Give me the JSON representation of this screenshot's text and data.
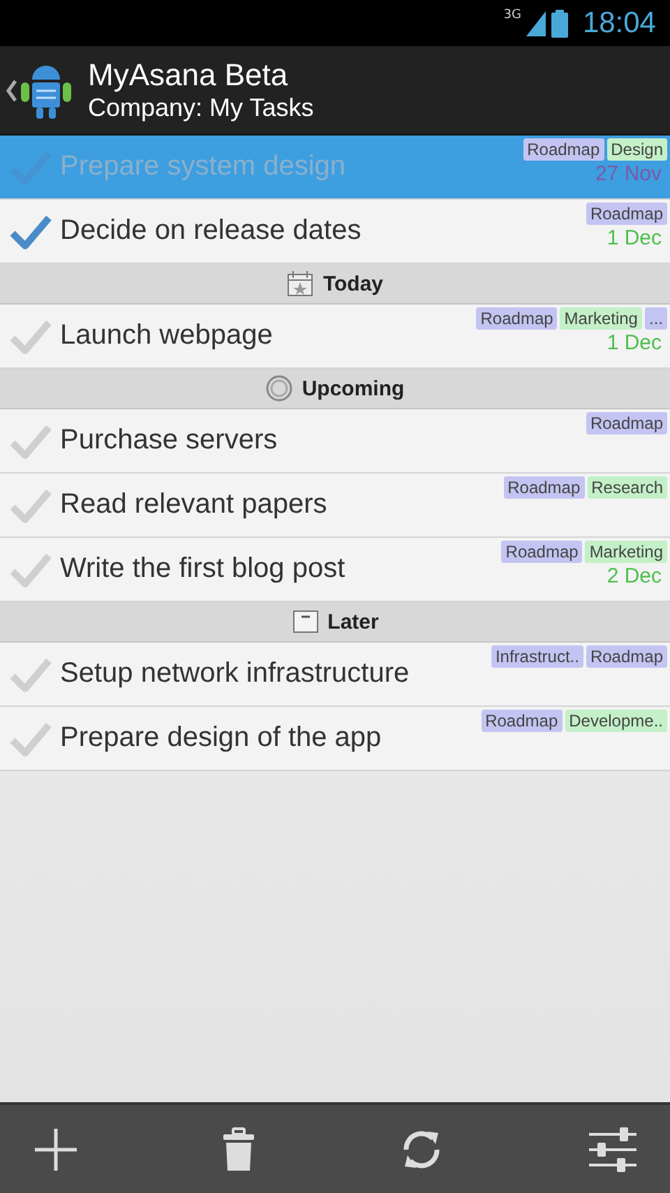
{
  "status_bar": {
    "network": "3G",
    "time": "18:04"
  },
  "header": {
    "title": "MyAsana Beta",
    "subtitle": "Company: My Tasks"
  },
  "list": [
    {
      "kind": "task",
      "title": "Prepare system design",
      "checked": true,
      "selected": true,
      "tags": [
        {
          "label": "Roadmap",
          "color": "#c4c4f2"
        },
        {
          "label": "Design",
          "color": "#c4f0c8"
        }
      ],
      "due": {
        "text": "27 Nov",
        "color": "#7a5aa8"
      }
    },
    {
      "kind": "task",
      "title": "Decide on release dates",
      "checked": true,
      "selected": false,
      "tags": [
        {
          "label": "Roadmap",
          "color": "#c4c4f2"
        }
      ],
      "due": {
        "text": "1 Dec",
        "color": "#4cc04c"
      }
    },
    {
      "kind": "section",
      "title": "Today"
    },
    {
      "kind": "task",
      "title": "Launch webpage",
      "checked": false,
      "selected": false,
      "tags": [
        {
          "label": "Roadmap",
          "color": "#c4c4f2"
        },
        {
          "label": "Marketing",
          "color": "#c4f0c8"
        },
        {
          "label": "...",
          "color": "#c4c4f2"
        }
      ],
      "due": {
        "text": "1 Dec",
        "color": "#4cc04c"
      }
    },
    {
      "kind": "section",
      "title": "Upcoming"
    },
    {
      "kind": "task",
      "title": "Purchase servers",
      "checked": false,
      "selected": false,
      "tags": [
        {
          "label": "Roadmap",
          "color": "#c4c4f2"
        }
      ]
    },
    {
      "kind": "task",
      "title": "Read relevant papers",
      "checked": false,
      "selected": false,
      "tags": [
        {
          "label": "Roadmap",
          "color": "#c4c4f2"
        },
        {
          "label": "Research",
          "color": "#c4f0c8"
        }
      ]
    },
    {
      "kind": "task",
      "title": "Write the first blog post",
      "checked": false,
      "selected": false,
      "tags": [
        {
          "label": "Roadmap",
          "color": "#c4c4f2"
        },
        {
          "label": "Marketing",
          "color": "#c4f0c8"
        }
      ],
      "due": {
        "text": "2 Dec",
        "color": "#4cc04c"
      }
    },
    {
      "kind": "section",
      "title": "Later"
    },
    {
      "kind": "task",
      "title": "Setup network infrastructure",
      "checked": false,
      "selected": false,
      "tags": [
        {
          "label": "Infrastruct..",
          "color": "#c4c4f2"
        },
        {
          "label": "Roadmap",
          "color": "#c4c4f2"
        }
      ]
    },
    {
      "kind": "task",
      "title": "Prepare design of the app",
      "checked": false,
      "selected": false,
      "tags": [
        {
          "label": "Roadmap",
          "color": "#c4c4f2"
        },
        {
          "label": "Developme..",
          "color": "#c4f0c8"
        }
      ]
    }
  ]
}
